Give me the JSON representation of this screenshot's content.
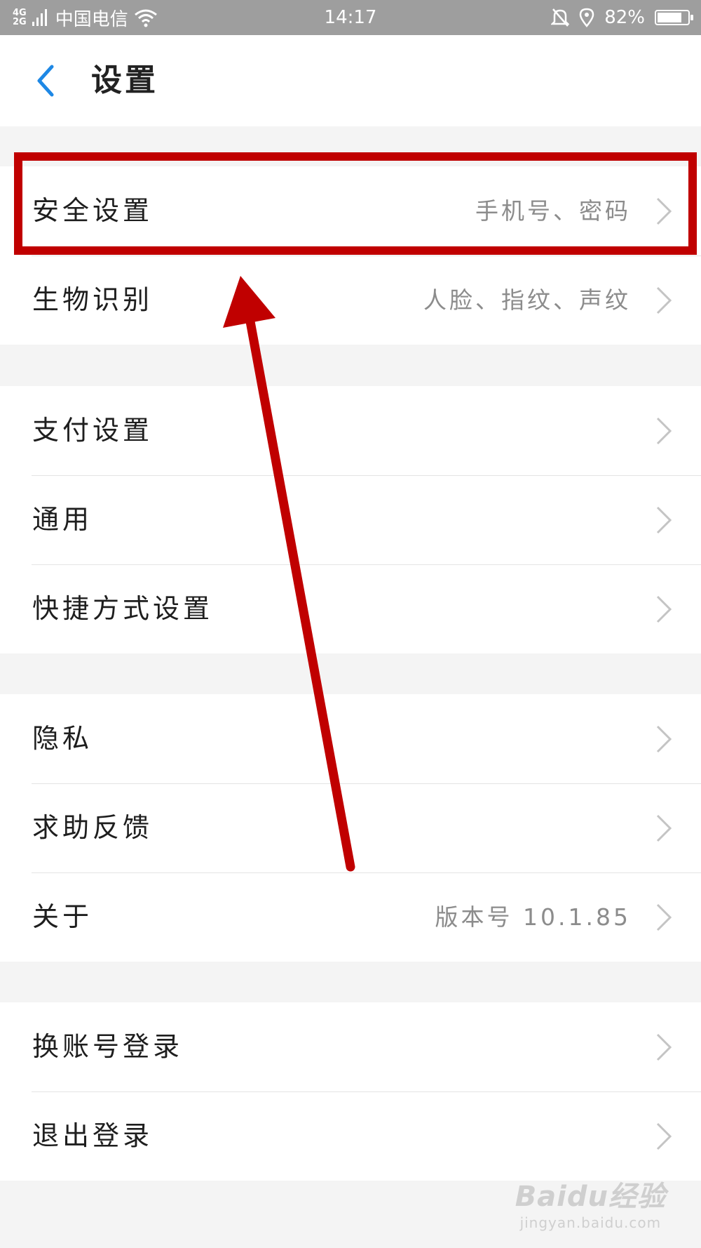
{
  "status_bar": {
    "network_type_top": "4G",
    "network_type_bottom": "2G",
    "carrier": "中国电信",
    "time": "14:17",
    "battery_percent": "82%",
    "battery_level": 0.82,
    "icons": [
      "signal-icon",
      "wifi-icon",
      "bell-off-icon",
      "location-icon",
      "battery-icon"
    ]
  },
  "header": {
    "back_icon": "back-chevron-icon",
    "title": "设置"
  },
  "groups": [
    [
      {
        "label": "安全设置",
        "value": "手机号、密码"
      },
      {
        "label": "生物识别",
        "value": "人脸、指纹、声纹"
      }
    ],
    [
      {
        "label": "支付设置",
        "value": ""
      },
      {
        "label": "通用",
        "value": ""
      },
      {
        "label": "快捷方式设置",
        "value": ""
      }
    ],
    [
      {
        "label": "隐私",
        "value": ""
      },
      {
        "label": "求助反馈",
        "value": ""
      },
      {
        "label": "关于",
        "value": "版本号 10.1.85"
      }
    ],
    [
      {
        "label": "换账号登录",
        "value": ""
      },
      {
        "label": "退出登录",
        "value": ""
      }
    ]
  ],
  "colors": {
    "accent": "#1e88e5",
    "annotation": "#c00000",
    "status_bar_bg": "#9e9e9e",
    "chevron": "#c4c4c4"
  },
  "watermark": {
    "logo": "Baidu经验",
    "url": "jingyan.baidu.com"
  }
}
